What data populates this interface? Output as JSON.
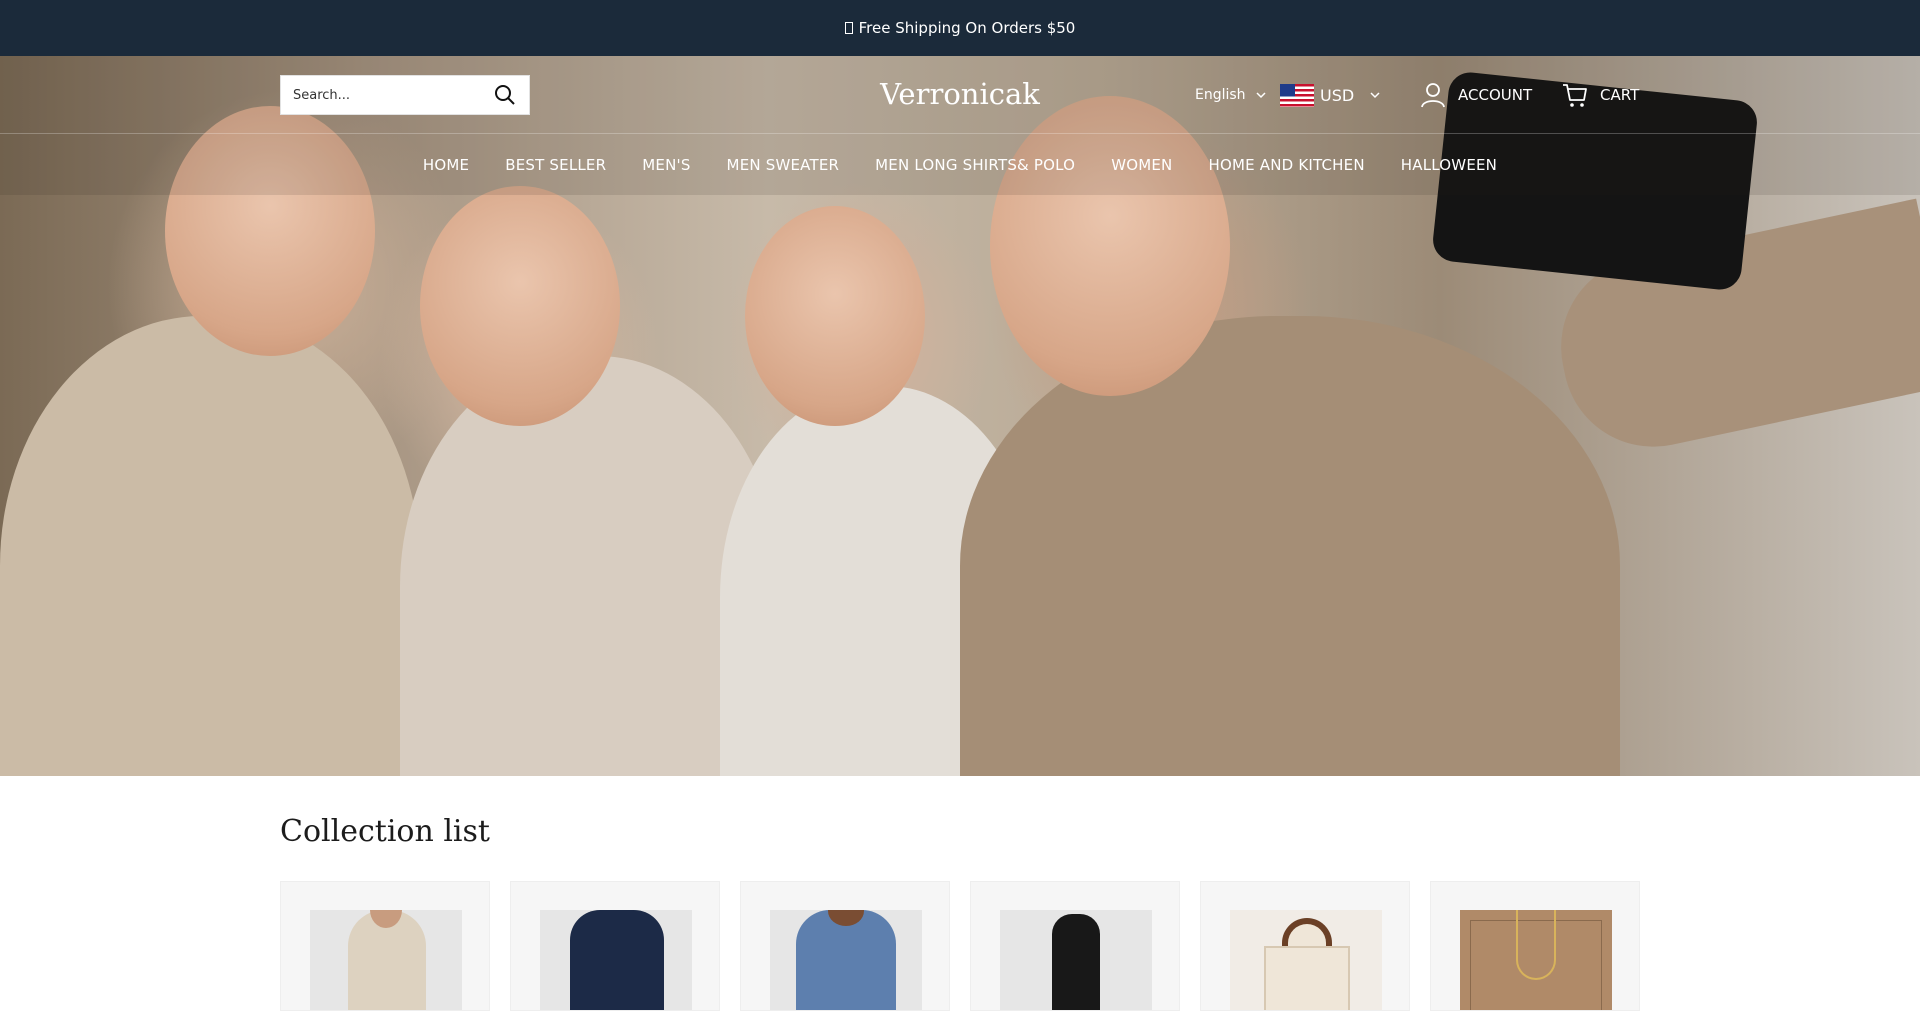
{
  "announcement": {
    "text": "Free Shipping On Orders $50"
  },
  "header": {
    "search_placeholder": "Search...",
    "logo": "Verronicak",
    "language": "English",
    "currency": "USD",
    "account_label": "ACCOUNT",
    "cart_label": "CART"
  },
  "nav": {
    "items": [
      {
        "label": "HOME"
      },
      {
        "label": "BEST SELLER"
      },
      {
        "label": "MEN'S"
      },
      {
        "label": "MEN SWEATER"
      },
      {
        "label": "MEN LONG SHIRTS& POLO"
      },
      {
        "label": "WOMEN"
      },
      {
        "label": "HOME AND KITCHEN"
      },
      {
        "label": "HALLOWEEN"
      }
    ]
  },
  "collection": {
    "title": "Collection list"
  },
  "colors": {
    "announcement_bg": "#1b2a3a",
    "text_on_dark": "#ffffff",
    "card_bg": "#f6f6f6"
  }
}
